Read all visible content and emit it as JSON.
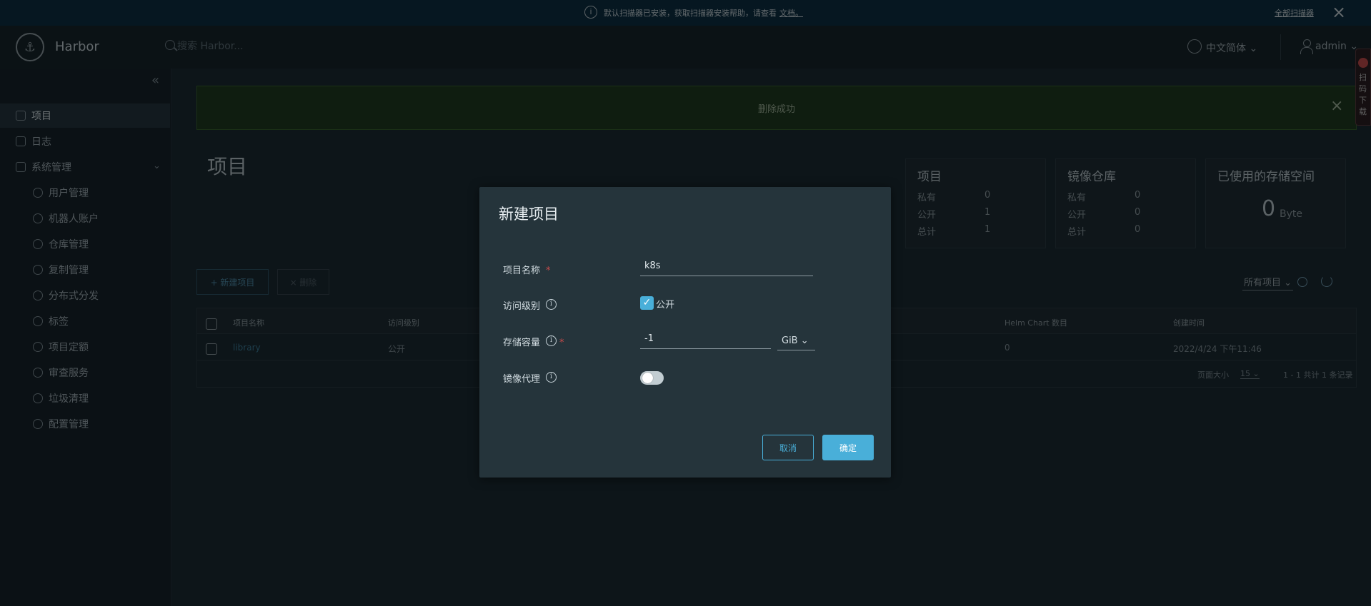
{
  "banner": {
    "message": "默认扫描器已安装，获取扫描器安装帮助，请查看",
    "doc_link": "文档。",
    "all_scanners": "全部扫描器"
  },
  "header": {
    "brand": "Harbor",
    "search_placeholder": "搜索 Harbor...",
    "language": "中文简体",
    "user": "admin"
  },
  "sidebar": {
    "items": [
      {
        "label": "项目"
      },
      {
        "label": "日志"
      },
      {
        "label": "系统管理"
      },
      {
        "label": "用户管理"
      },
      {
        "label": "机器人账户"
      },
      {
        "label": "仓库管理"
      },
      {
        "label": "复制管理"
      },
      {
        "label": "分布式分发"
      },
      {
        "label": "标签"
      },
      {
        "label": "项目定额"
      },
      {
        "label": "审查服务"
      },
      {
        "label": "垃圾清理"
      },
      {
        "label": "配置管理"
      }
    ]
  },
  "alert": {
    "message": "删除成功"
  },
  "page": {
    "title": "项目"
  },
  "stats": {
    "projects": {
      "title": "项目",
      "private_label": "私有",
      "private": "0",
      "public_label": "公开",
      "public": "1",
      "total_label": "总计",
      "total": "1"
    },
    "repos": {
      "title": "镜像仓库",
      "private_label": "私有",
      "private": "0",
      "public_label": "公开",
      "public": "0",
      "total_label": "总计",
      "total": "0"
    },
    "storage": {
      "title": "已使用的存储空间",
      "value": "0",
      "unit": "Byte"
    }
  },
  "toolbar": {
    "new_project": "+ 新建项目",
    "delete": "× 删除",
    "filter": "所有项目"
  },
  "table": {
    "columns": [
      "项目名称",
      "访问级别",
      "Helm Chart 数目",
      "创建时间"
    ],
    "rows": [
      {
        "name": "library",
        "access": "公开",
        "helm_charts": "0",
        "created": "2022/4/24 下午11:46"
      }
    ],
    "page_size_label": "页面大小",
    "page_size": "15",
    "summary": "1 - 1 共计 1 条记录"
  },
  "float_badge": "扫码下载",
  "modal": {
    "title": "新建项目",
    "name_label": "项目名称",
    "name_value": "k8s",
    "access_label": "访问级别",
    "public_label": "公开",
    "public_checked": true,
    "quota_label": "存储容量",
    "quota_value": "-1",
    "quota_unit": "GiB",
    "proxy_label": "镜像代理",
    "proxy_enabled": false,
    "cancel": "取消",
    "ok": "确定"
  },
  "colors": {
    "accent": "#49afd9",
    "required": "#c84b4b",
    "success_bg": "#1f3a20"
  }
}
